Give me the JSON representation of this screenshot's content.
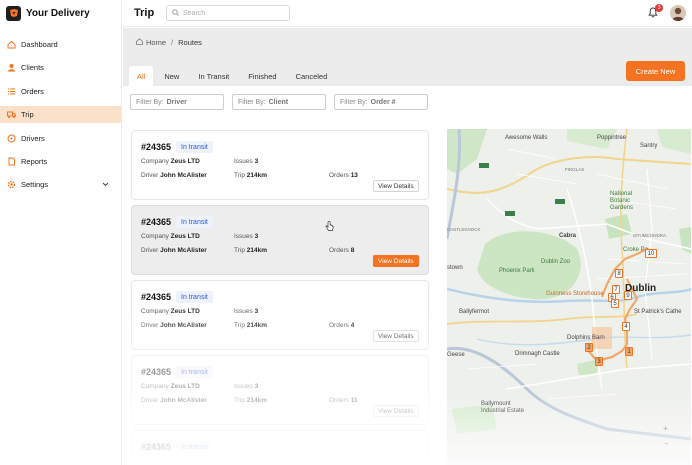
{
  "brand": {
    "name": "Your Delivery"
  },
  "sidebar": {
    "items": [
      {
        "label": "Dashboard",
        "icon": "home-icon"
      },
      {
        "label": "Clients",
        "icon": "user-icon"
      },
      {
        "label": "Orders",
        "icon": "list-icon"
      },
      {
        "label": "Trip",
        "icon": "truck-icon",
        "active": true
      },
      {
        "label": "Drivers",
        "icon": "driver-icon"
      },
      {
        "label": "Reports",
        "icon": "document-icon"
      },
      {
        "label": "Settings",
        "icon": "gear-icon",
        "expandable": true
      }
    ]
  },
  "topbar": {
    "title": "Trip",
    "search_placeholder": "Search",
    "notification_count": "3"
  },
  "breadcrumb": {
    "home": "Home",
    "separator": "/",
    "current": "Routes"
  },
  "tabs": [
    {
      "label": "All",
      "active": true
    },
    {
      "label": "New"
    },
    {
      "label": "In Transit"
    },
    {
      "label": "Finished"
    },
    {
      "label": "Canceled"
    }
  ],
  "create_button": "Create New",
  "filters": [
    {
      "prefix": "Filter By:",
      "field": "Driver"
    },
    {
      "prefix": "Filter By:",
      "field": "Client"
    },
    {
      "prefix": "Filter By:",
      "field": "Order #"
    }
  ],
  "trips": [
    {
      "order": "#24365",
      "status": "In transit",
      "company_label": "Company",
      "company": "Zeus LTD",
      "issues_label": "Issues",
      "issues": "3",
      "driver_label": "Driver",
      "driver": "John McAlister",
      "trip_label": "Trip",
      "trip": "214km",
      "orders_label": "Orders",
      "orders": "13",
      "action": "View Details"
    },
    {
      "order": "#24365",
      "status": "In transit",
      "company_label": "Company",
      "company": "Zeus LTD",
      "issues_label": "Issues",
      "issues": "3",
      "driver_label": "Driver",
      "driver": "John McAlister",
      "trip_label": "Trip",
      "trip": "214km",
      "orders_label": "Orders",
      "orders": "8",
      "action": "View Details"
    },
    {
      "order": "#24365",
      "status": "In transit",
      "company_label": "Company",
      "company": "Zeus LTD",
      "issues_label": "Issues",
      "issues": "3",
      "driver_label": "Driver",
      "driver": "John McAlister",
      "trip_label": "Trip",
      "trip": "214km",
      "orders_label": "Orders",
      "orders": "4",
      "action": "View Details"
    },
    {
      "order": "#24365",
      "status": "In transit",
      "company_label": "Company",
      "company": "Zeus LTD",
      "issues_label": "Issues",
      "issues": "3",
      "driver_label": "Driver",
      "driver": "John McAlister",
      "trip_label": "Trip",
      "trip": "214km",
      "orders_label": "Orders",
      "orders": "11",
      "action": "View Details"
    },
    {
      "order": "#24365",
      "status": "In transit"
    }
  ],
  "map": {
    "labels": {
      "awesome_walls": "Awesome Walls",
      "poppintree": "Poppintree",
      "santry": "Santry",
      "finglas": "FINGLAS",
      "national_gardens": "National\nBotanic\nGardens",
      "cabra": "Cabra",
      "drumcondra": "DRUMCONDRA",
      "dublin_zoo": "Dublin Zoo",
      "phoenix_park": "Phoenix Park",
      "croke_park": "Croke Pa",
      "dublin": "Dublin",
      "guinness": "Guinness Storehouse",
      "st_patricks": "St Patrick's Cathe",
      "ballyfermot": "Ballyfermot",
      "dolphins_barn": "Dolphins Barn",
      "drimnagh_castle": "Drimnagh Castle",
      "ballymount": "Ballymount\nIndustrial Estate",
      "castleknock": "CASTLEKNOCK",
      "town": "stown",
      "geese": "Geese"
    },
    "pins": [
      "1",
      "2",
      "3",
      "4",
      "5",
      "6",
      "7",
      "8",
      "9",
      "10"
    ]
  },
  "colors": {
    "accent": "#f37321",
    "status_blue": "#2e5bd6",
    "active_nav": "#fbe1c9"
  }
}
